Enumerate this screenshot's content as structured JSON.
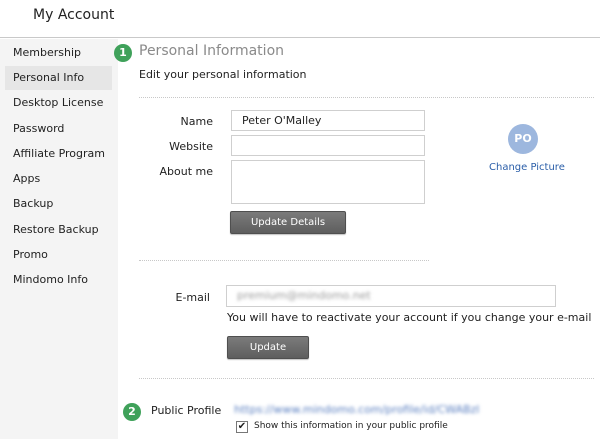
{
  "header": {
    "title": "My Account"
  },
  "sidebar": {
    "items": [
      {
        "label": "Membership"
      },
      {
        "label": "Personal Info",
        "active": true
      },
      {
        "label": "Desktop License"
      },
      {
        "label": "Password"
      },
      {
        "label": "Affiliate Program"
      },
      {
        "label": "Apps"
      },
      {
        "label": "Backup"
      },
      {
        "label": "Restore Backup"
      },
      {
        "label": "Promo"
      },
      {
        "label": "Mindomo Info"
      }
    ]
  },
  "personal_info": {
    "step_number": "1",
    "title": "Personal Information",
    "subtitle": "Edit your personal information",
    "name_label": "Name",
    "name_value": "Peter O'Malley",
    "website_label": "Website",
    "website_value": "",
    "about_label": "About me",
    "about_value": "",
    "update_details_label": "Update Details",
    "avatar_initials": "PO",
    "change_picture_label": "Change Picture"
  },
  "email": {
    "label": "E-mail",
    "value": "premium@mindomo.net",
    "help_text": "You will have to reactivate your account if you change your e-mail",
    "update_label": "Update"
  },
  "public_profile": {
    "step_number": "2",
    "label": "Public Profile",
    "url": "https://www.mindomo.com/profile/id/CWABzl",
    "show_info_label": "Show this information in your public profile",
    "show_info_checked": true,
    "checkmark": "✔"
  },
  "colors": {
    "accent_green": "#3fa15a",
    "link_blue": "#2a5ea8",
    "avatar_blue": "#9db7de",
    "button_gray": "#6b6b6b"
  }
}
